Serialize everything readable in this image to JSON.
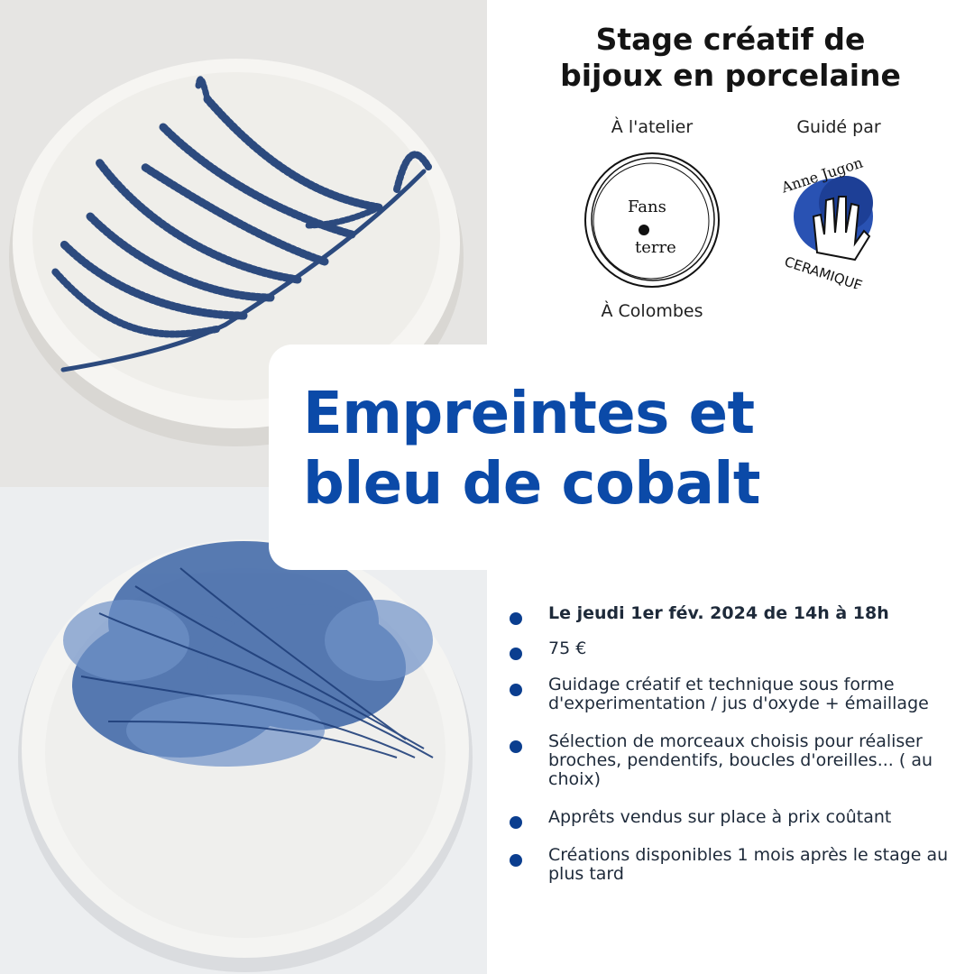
{
  "header": {
    "title_line1": "Stage créatif de",
    "title_line2": "bijoux en porcelaine"
  },
  "venue": {
    "label_top": "À l'atelier",
    "logo_text_1": "Fans",
    "logo_text_2": "terre",
    "label_bottom": "À Colombes"
  },
  "guide": {
    "label": "Guidé par",
    "logo_text_top": "Anne Jugon",
    "logo_text_bottom": "CERAMIQUE"
  },
  "main": {
    "title_line1": "Empreintes et",
    "title_line2": "bleu de cobalt"
  },
  "details": [
    {
      "text": "Le jeudi 1er fév. 2024 de 14h à 18h"
    },
    {
      "text": "75 €"
    },
    {
      "text": "Guidage créatif et technique sous forme d'experimentation / jus d'oxyde + émaillage"
    },
    {
      "text": "Sélection de morceaux choisis pour réaliser broches, pendentifs, boucles d'oreilles... ( au choix)"
    },
    {
      "text": "Apprêts vendus sur place à prix coûtant"
    },
    {
      "text": "Créations disponibles 1 mois après le stage au plus tard"
    }
  ],
  "colors": {
    "accent_blue": "#0b4aa8",
    "bullet_blue": "#0b3e8f",
    "cobalt": "#2b4f8c"
  }
}
